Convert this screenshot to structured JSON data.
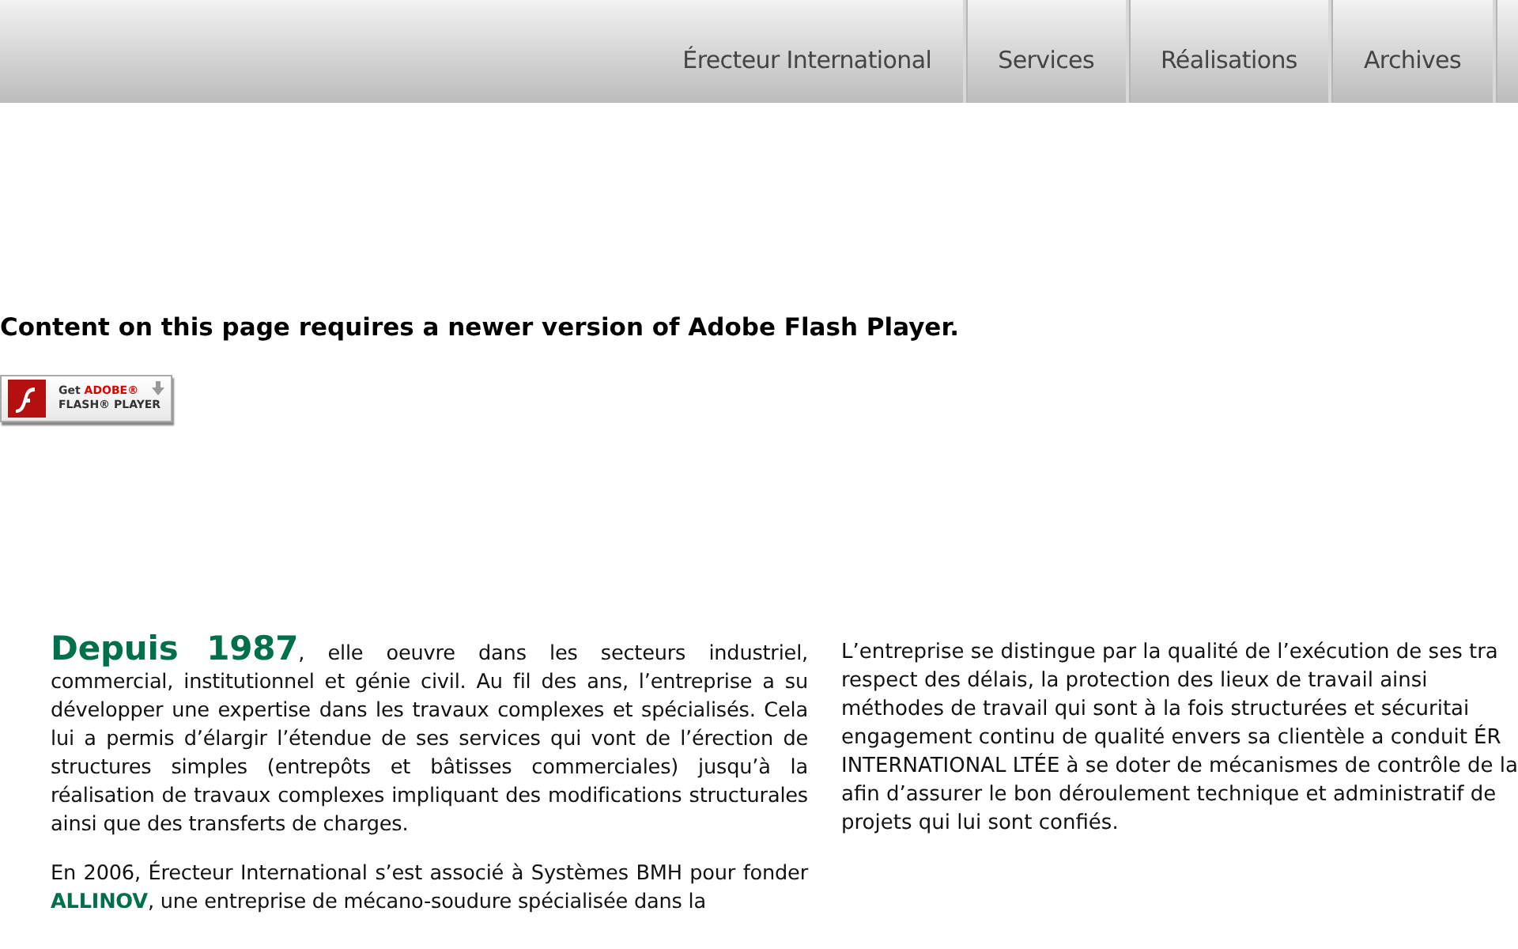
{
  "nav": {
    "tabs": [
      {
        "label": "Érecteur International",
        "selected": false
      },
      {
        "label": "Services",
        "selected": false
      },
      {
        "label": "Réalisations",
        "selected": false
      },
      {
        "label": "Archives",
        "selected": false
      }
    ]
  },
  "flash": {
    "message": "Content on this page requires a newer version of Adobe Flash Player.",
    "badge": {
      "get": "Get",
      "brand": "ADOBE®",
      "product": "FLASH® PLAYER"
    }
  },
  "left_column": {
    "lead": "Depuis 1987",
    "intro": ", elle oeuvre dans les secteurs industriel, commercial, institutionnel et génie civil. Au fil des ans, l’entreprise a su développer une expertise dans les travaux complexes et spécialisés. Cela lui a permis d’élargir l’étendue de ses services qui vont de l’érection de structures simples (entrepôts et bâtisses commerciales) jusqu’à la réalisation de travaux complexes impliquant des modifications structurales ainsi que des transferts de charges.",
    "paragraph": "En 2006, Érecteur International s’est associé à Systèmes BMH pour fonder **ALLINOV**, une entreprise de mécano-soudure spécialisée dans la"
  },
  "right_column": {
    "lines": [
      "L’entreprise se distingue par la qualité de l’exécution de ses tra",
      "respect des délais, la protection des lieux de travail ainsi",
      "méthodes de travail qui sont à la fois structurées et sécuritai",
      "engagement continu de qualité envers sa clientèle a conduit ÉR",
      "INTERNATIONAL LTÉE à se doter de mécanismes de contrôle de la",
      "afin d’assurer le bon déroulement technique et administratif de",
      "projets qui lui sont confiés."
    ]
  }
}
